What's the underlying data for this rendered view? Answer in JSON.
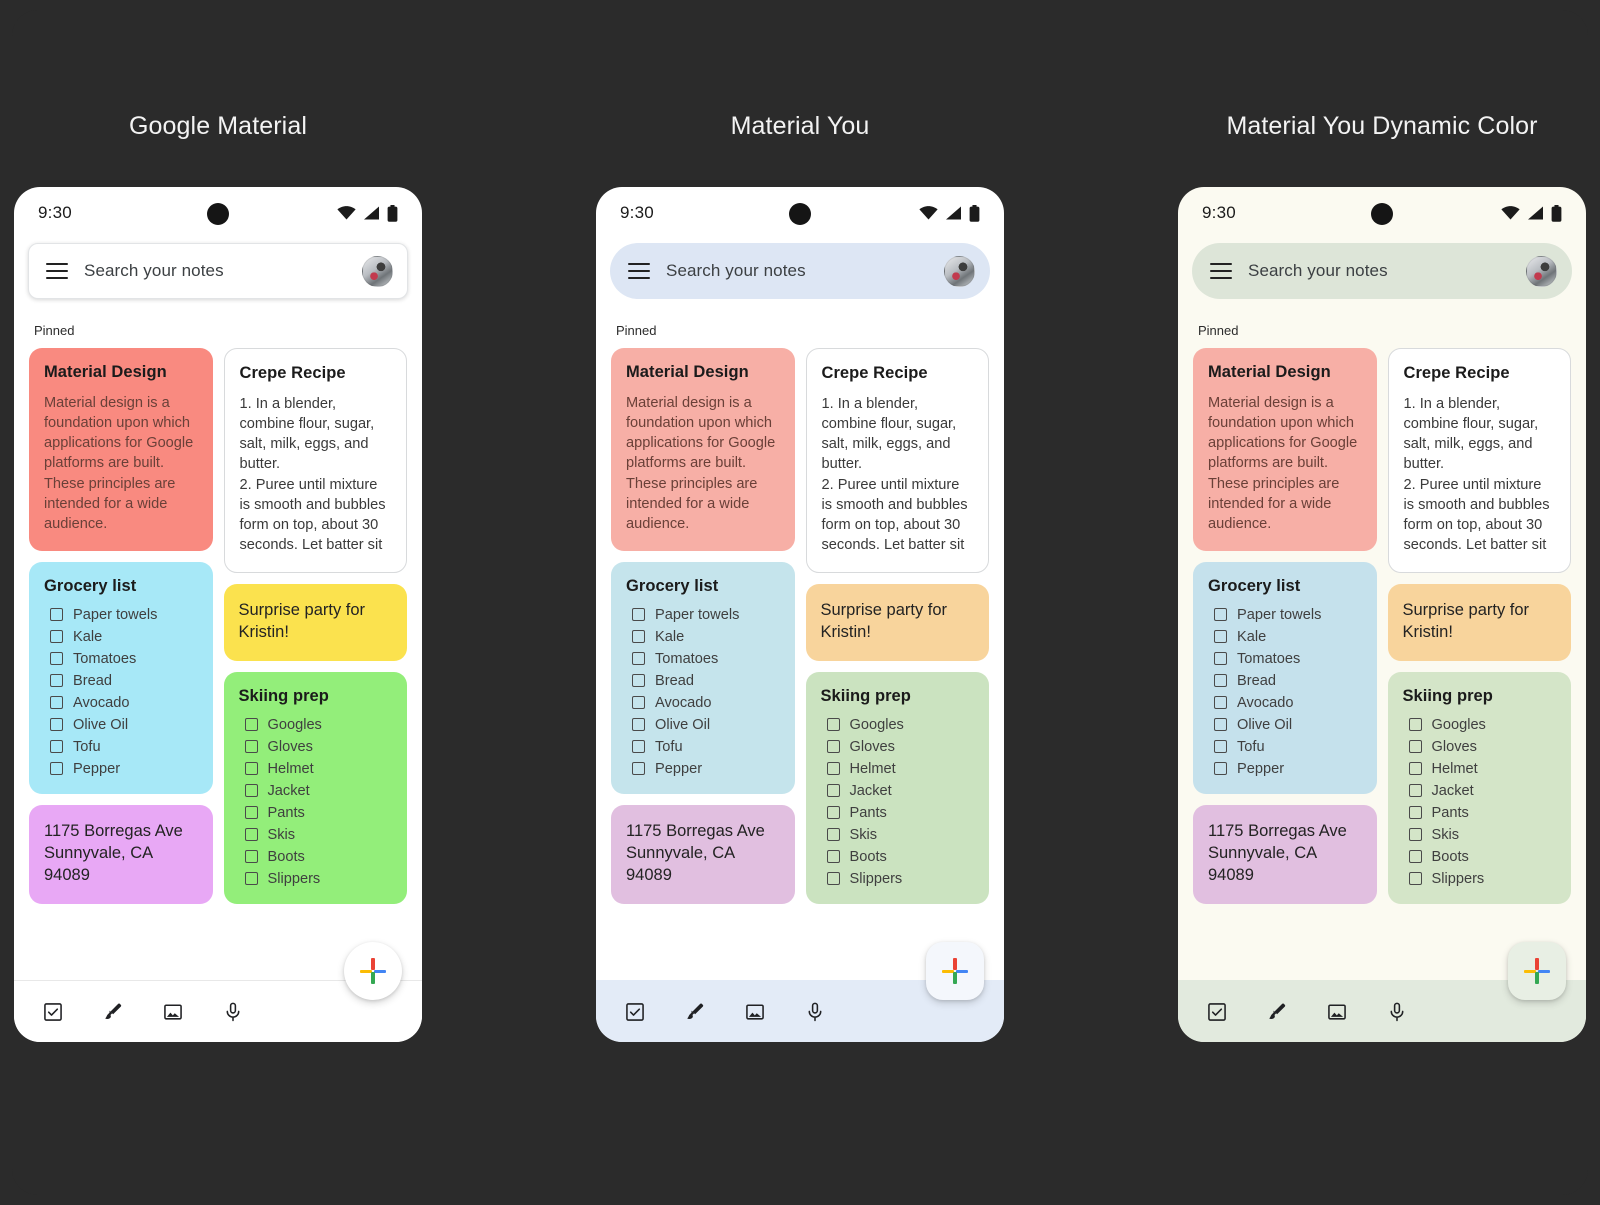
{
  "page": {
    "background": "#2b2b2b"
  },
  "common": {
    "status": {
      "time": "9:30",
      "wifi_icon": "wifi-icon",
      "signal_icon": "signal-icon",
      "battery_icon": "battery-icon",
      "camera_icon": "front-camera-dot"
    },
    "search": {
      "menu_icon": "hamburger-menu-icon",
      "placeholder": "Search your notes",
      "avatar_icon": "account-avatar"
    },
    "pinned_label": "Pinned",
    "bottom_bar": {
      "items": [
        {
          "icon": "checkbox-list-icon",
          "label": "New list"
        },
        {
          "icon": "brush-icon",
          "label": "New drawing"
        },
        {
          "icon": "image-icon",
          "label": "New image note"
        },
        {
          "icon": "microphone-icon",
          "label": "New voice note"
        }
      ]
    },
    "fab": {
      "icon": "google-plus-icon",
      "label": "New note"
    },
    "notes": {
      "material_design": {
        "title": "Material Design",
        "body": "Material design is a foundation upon which applications for Google platforms are built. These principles are intended for a wide audience."
      },
      "crepe_recipe": {
        "title": "Crepe Recipe",
        "body": "1. In a blender, combine flour, sugar, salt, milk, eggs, and butter.\n2. Puree until mixture is smooth and bubbles form on top, about 30 seconds. Let batter sit"
      },
      "grocery_list": {
        "title": "Grocery list",
        "items": [
          "Paper towels",
          "Kale",
          "Tomatoes",
          "Bread",
          "Avocado",
          "Olive Oil",
          "Tofu",
          "Pepper"
        ]
      },
      "surprise_party": {
        "body": "Surprise party for Kristin!"
      },
      "skiing_prep": {
        "title": "Skiing prep",
        "items": [
          "Googles",
          "Gloves",
          "Helmet",
          "Jacket",
          "Pants",
          "Skis",
          "Boots",
          "Slippers"
        ]
      },
      "address": {
        "body": "1175 Borregas Ave Sunnyvale, CA 94089"
      }
    }
  },
  "phones": [
    {
      "id": "google-material",
      "title": "Google Material",
      "theme": {
        "surface": "#ffffff",
        "search_bg": "#ffffff",
        "search_border": "#e2e4e6",
        "search_shadow": "0 1px 4px rgba(0,0,0,.16)",
        "bottom_bar_bg": "#ffffff",
        "bottom_bar_border": "#e8e8e8",
        "fab_bg": "#ffffff",
        "fab_shape": "round",
        "note_red": "#f98a80",
        "note_blue": "#a7e8f7",
        "note_yellow": "#fbe24e",
        "note_green": "#93ee7a",
        "note_purple": "#e8a8f5",
        "note_body_tint": "#6a4038",
        "icon_color": "#202124"
      }
    },
    {
      "id": "material-you",
      "title": "Material You",
      "theme": {
        "surface": "#ffffff",
        "search_bg": "#dde6f4",
        "search_border": "transparent",
        "search_shadow": "none",
        "bottom_bar_bg": "#e3ebf7",
        "bottom_bar_border": "transparent",
        "fab_bg": "#f4f7fc",
        "fab_shape": "squircle",
        "note_red": "#f7afa6",
        "note_blue": "#c5e4ec",
        "note_yellow": "#f8d49c",
        "note_green": "#cbe3c0",
        "note_purple": "#e1bfe0",
        "note_body_tint": "#6a4038",
        "icon_color": "#202124"
      }
    },
    {
      "id": "material-you-dynamic",
      "title": "Material You Dynamic Color",
      "theme": {
        "surface": "#fbfaf1",
        "search_bg": "#dde5d8",
        "search_border": "transparent",
        "search_shadow": "none",
        "bottom_bar_bg": "#e2eade",
        "bottom_bar_border": "transparent",
        "fab_bg": "#e8efe4",
        "fab_shape": "squircle",
        "note_red": "#f7afa6",
        "note_blue": "#c5e1ec",
        "note_yellow": "#f8d49c",
        "note_green": "#d4e5c8",
        "note_purple": "#e1bfe0",
        "note_body_tint": "#6a4038",
        "icon_color": "#202124"
      }
    }
  ]
}
